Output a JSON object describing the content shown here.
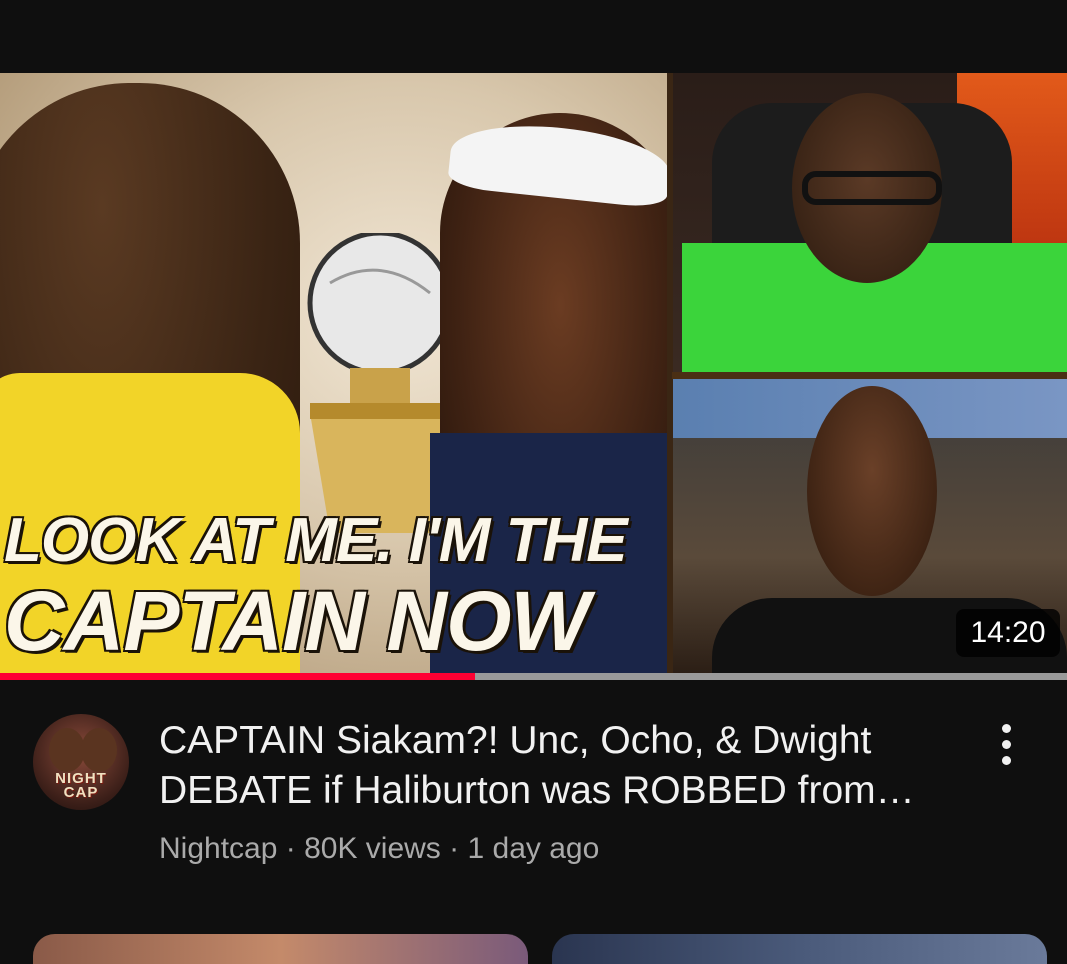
{
  "thumbnail": {
    "overlay_text_line1": "LOOK AT ME. I'M THE",
    "overlay_text_line2": "CAPTAIN NOW",
    "duration": "14:20",
    "watch_progress": 0.445,
    "progress_color": "#ff0033"
  },
  "video": {
    "title_line1": "CAPTAIN Siakam?! Unc, Ocho, & Dwight",
    "title_line2": "DEBATE if Haliburton was ROBBED from…",
    "channel": "Nightcap",
    "separator": " · ",
    "views": "80K views",
    "age": "1 day ago"
  },
  "channel_avatar": {
    "logo_text_line1": "NIGHT",
    "logo_text_line2": "CAP"
  },
  "menu": {
    "icon": "more-vert-icon"
  }
}
